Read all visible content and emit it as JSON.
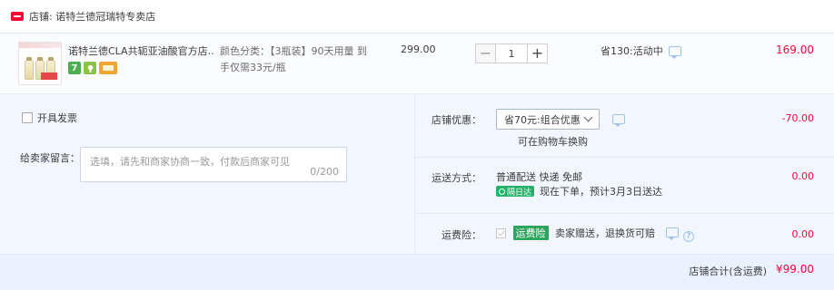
{
  "shop": {
    "label": "店铺: 诺特兰德冠瑞特专卖店"
  },
  "item": {
    "title": "诺特兰德CLA共轭亚油酸官方店...",
    "sku": "颜色分类：【3瓶装】90天用量 到手仅需33元/瓶",
    "unit_price": "299.00",
    "quantity": "1",
    "qty_minus": "−",
    "qty_plus": "+",
    "promo": "省130:活动中",
    "subtotal": "169.00",
    "service_icons": [
      "seven-day-return-icon",
      "green-service-icon",
      "card-payment-icon"
    ],
    "seven_label": "7"
  },
  "invoice": {
    "label": "开具发票"
  },
  "message": {
    "label": "给卖家留言：",
    "placeholder": "选填，请先和商家协商一致，付款后商家可见",
    "count": "0/200"
  },
  "discount": {
    "label": "店铺优惠：",
    "selected": "省70元:组合优惠",
    "note": "可在购物车换购",
    "value": "-70.00"
  },
  "shipping": {
    "label": "运送方式：",
    "method": "普通配送 快递 免邮",
    "badge": "隔日达",
    "eta": "现在下单，预计3月3日送达",
    "value": "0.00"
  },
  "insurance": {
    "label": "运费险：",
    "badge": "运费险",
    "desc": "卖家赠送，退换货可赔",
    "value": "0.00",
    "help": "?"
  },
  "total": {
    "label": "店铺合计(含运费)",
    "value": "¥99.00"
  },
  "colors": {
    "accent": "#ff0036",
    "panel_bg": "#f2f7ff",
    "green_badge": "#2ea55d"
  }
}
